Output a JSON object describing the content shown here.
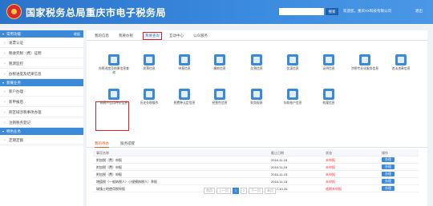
{
  "header": {
    "title": "国家税务总局重庆市电子税务局",
    "search_button": "搜索",
    "user_info": "欢迎您，重庆XX科技有限公司",
    "logout": "退出"
  },
  "sidebar": {
    "sections": [
      {
        "title": "常用功能",
        "collapse": "收起",
        "items": [
          "发票认证",
          "税收完税（费）证明",
          "税源监控",
          "办税进度及结果信息"
        ]
      },
      {
        "title": "套餐业务",
        "items": [
          "新户办理",
          "新申报后",
          "跨区域涉税事项办理",
          "注销税务登记"
        ]
      },
      {
        "title": "特色业务",
        "items": [
          "定期定额"
        ]
      }
    ]
  },
  "top_tabs": [
    "我的信息",
    "我要办税",
    "我要查询",
    "互动中心",
    "公众服务"
  ],
  "icons": [
    {
      "label": "办税进度及结果信息查询",
      "color": "#3a8ad9"
    },
    {
      "label": "发票信息",
      "color": "#3a8ad9"
    },
    {
      "label": "申报信息",
      "color": "#3a8ad9"
    },
    {
      "label": "缴款信息",
      "color": "#3a8ad9"
    },
    {
      "label": "欠税信息",
      "color": "#3a8ad9"
    },
    {
      "label": "优惠信息",
      "color": "#3a8ad9"
    },
    {
      "label": "证明信息",
      "color": "#3a8ad9"
    },
    {
      "label": "涉税专业化服务信息",
      "color": "#3a8ad9"
    },
    {
      "label": "违法违章信息",
      "color": "#3a8ad9"
    },
    {
      "label": "纳税人信用评价信息",
      "color": "#3a8ad9"
    },
    {
      "label": "历史办税操作",
      "color": "#3a8ad9"
    },
    {
      "label": "税费种认定信息",
      "color": "#3a8ad9"
    },
    {
      "label": "经营性信息",
      "color": "#3a8ad9"
    },
    {
      "label": "财务报表",
      "color": "#3a8ad9"
    },
    {
      "label": "存款账户信息",
      "color": "#3a8ad9"
    },
    {
      "label": "档案信息",
      "color": "#3a8ad9"
    }
  ],
  "sub_tabs": [
    "我的待办",
    "服务提醒"
  ],
  "table": {
    "headers": [
      "事项名称",
      "截止日期",
      "状态",
      "操作"
    ],
    "rows": [
      {
        "name": "附加税（费）申报",
        "date": "2016-11-15",
        "status": "未申报",
        "action": "办理"
      },
      {
        "name": "附加税（费）申报",
        "date": "2016-11-15",
        "status": "未申报",
        "action": "办理"
      },
      {
        "name": "附加税（费）申报",
        "date": "2016-11-15",
        "status": "未申报",
        "action": "办理"
      },
      {
        "name": "增值税（一般纳税人）小规模纳税人）季报",
        "date": "2016-11-15",
        "status": "未申报",
        "action": "办理"
      },
      {
        "name": "城镇土地使用税申报",
        "date": "2017-10-31",
        "status": "逾期未申报",
        "action": "办理"
      }
    ]
  },
  "pager": {
    "first": "首页",
    "prev": "上一页",
    "pages": [
      "1",
      "2"
    ],
    "next": "下一页",
    "last": "末页"
  }
}
